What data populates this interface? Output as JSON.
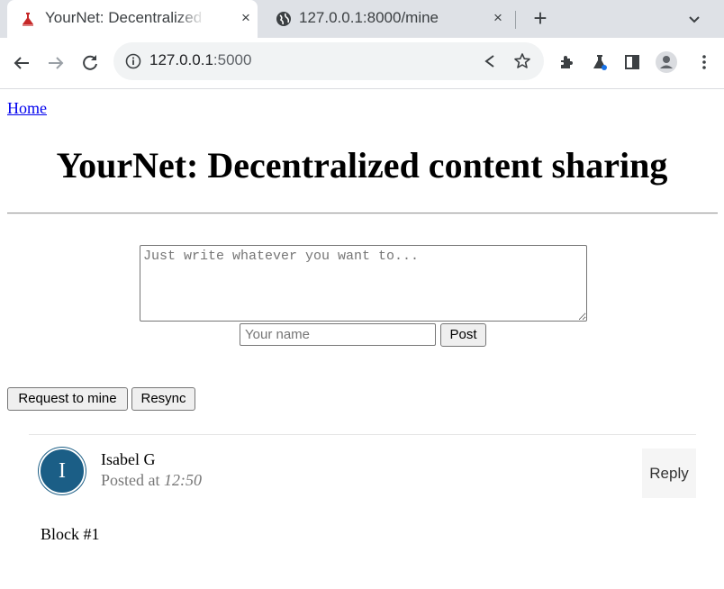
{
  "browser": {
    "tabs": [
      {
        "title": "YourNet: Decentralized content sharing",
        "active": true,
        "close": "×"
      },
      {
        "title": "127.0.0.1:8000/mine",
        "active": false,
        "close": "×"
      }
    ],
    "new_tab": "+",
    "address": {
      "host": "127.0.0.1",
      "port": ":5000"
    }
  },
  "page": {
    "home_link": "Home",
    "title": "YourNet: Decentralized content sharing",
    "compose": {
      "content_placeholder": "Just write whatever you want to...",
      "name_placeholder": "Your name",
      "post_button": "Post"
    },
    "actions": {
      "mine_button": "Request to mine",
      "resync_button": "Resync"
    },
    "posts": [
      {
        "avatar_initial": "I",
        "author": "Isabel G",
        "posted_prefix": "Posted at",
        "time": "12:50",
        "reply_label": "Reply",
        "content": "Block #1"
      }
    ]
  },
  "colors": {
    "link": "#0000ee",
    "avatar": "#1b5e86",
    "tabstrip": "#dee1e6"
  },
  "icons": [
    "flask-favicon",
    "globe-icon",
    "back-arrow-icon",
    "forward-arrow-icon",
    "reload-icon",
    "info-icon",
    "share-icon",
    "star-icon",
    "extensions-icon",
    "labs-flask-icon",
    "side-panel-icon",
    "profile-icon",
    "kebab-menu-icon",
    "chevron-down-icon"
  ]
}
